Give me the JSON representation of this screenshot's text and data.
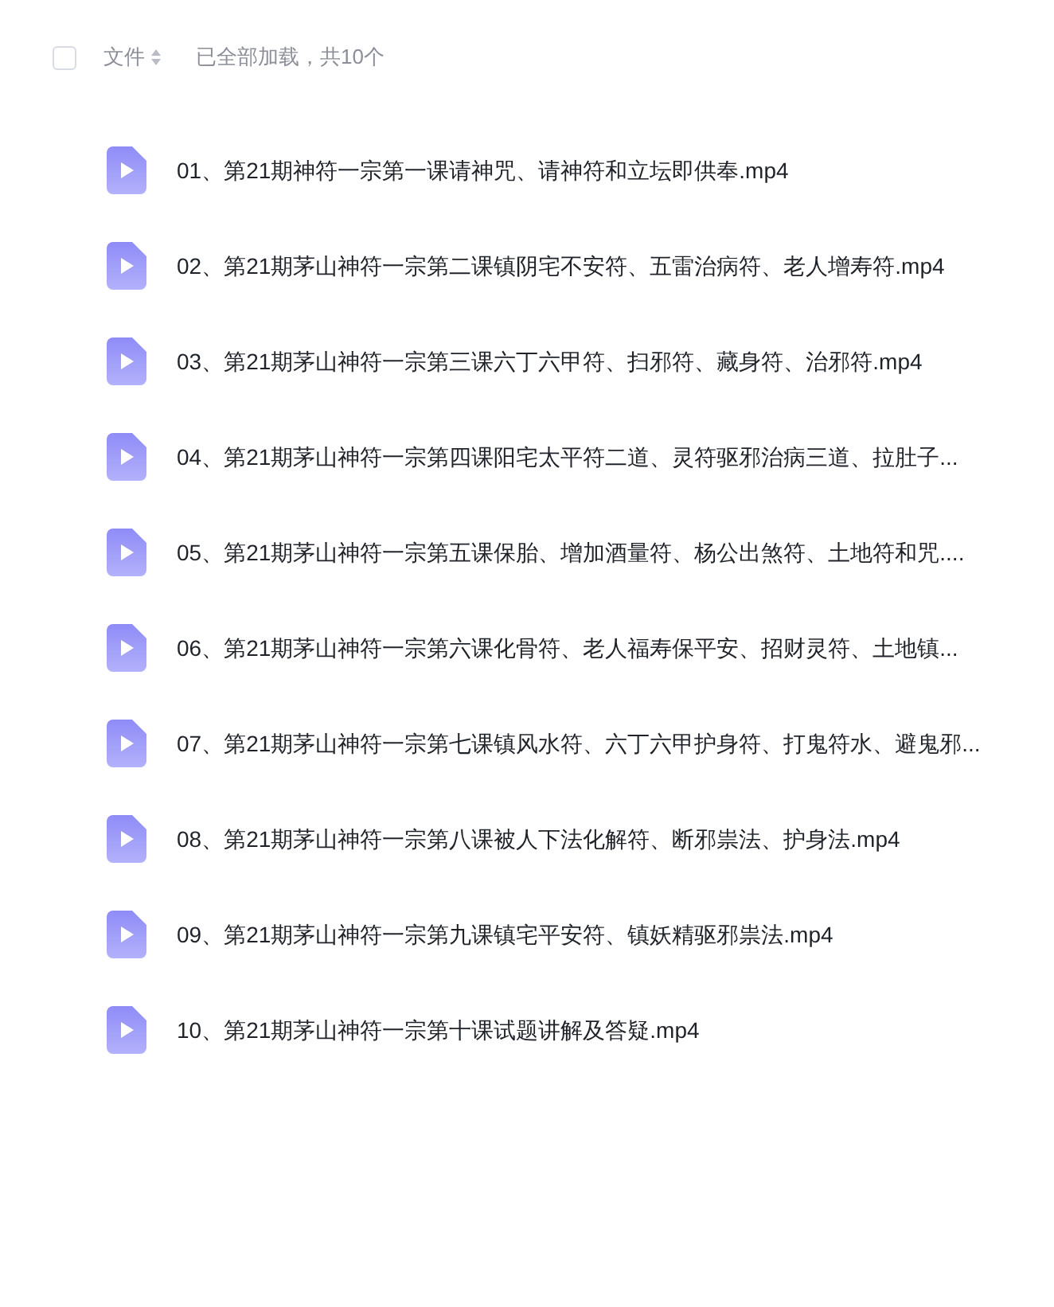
{
  "header": {
    "select_all": {
      "checked": false
    },
    "column_label": "文件",
    "status": "已全部加载，共10个"
  },
  "files": [
    {
      "name": "01、第21期神符一宗第一课请神咒、请神符和立坛即供奉.mp4",
      "kind": "video"
    },
    {
      "name": "02、第21期茅山神符一宗第二课镇阴宅不安符、五雷治病符、老人增寿符.mp4",
      "kind": "video"
    },
    {
      "name": "03、第21期茅山神符一宗第三课六丁六甲符、扫邪符、藏身符、治邪符.mp4",
      "kind": "video"
    },
    {
      "name": "04、第21期茅山神符一宗第四课阳宅太平符二道、灵符驱邪治病三道、拉肚子...",
      "kind": "video"
    },
    {
      "name": "05、第21期茅山神符一宗第五课保胎、增加酒量符、杨公出煞符、土地符和咒....",
      "kind": "video"
    },
    {
      "name": "06、第21期茅山神符一宗第六课化骨符、老人福寿保平安、招财灵符、土地镇...",
      "kind": "video"
    },
    {
      "name": "07、第21期茅山神符一宗第七课镇风水符、六丁六甲护身符、打鬼符水、避鬼邪...",
      "kind": "video"
    },
    {
      "name": "08、第21期茅山神符一宗第八课被人下法化解符、断邪祟法、护身法.mp4",
      "kind": "video"
    },
    {
      "name": "09、第21期茅山神符一宗第九课镇宅平安符、镇妖精驱邪祟法.mp4",
      "kind": "video"
    },
    {
      "name": "10、第21期茅山神符一宗第十课试题讲解及答疑.mp4",
      "kind": "video"
    }
  ]
}
